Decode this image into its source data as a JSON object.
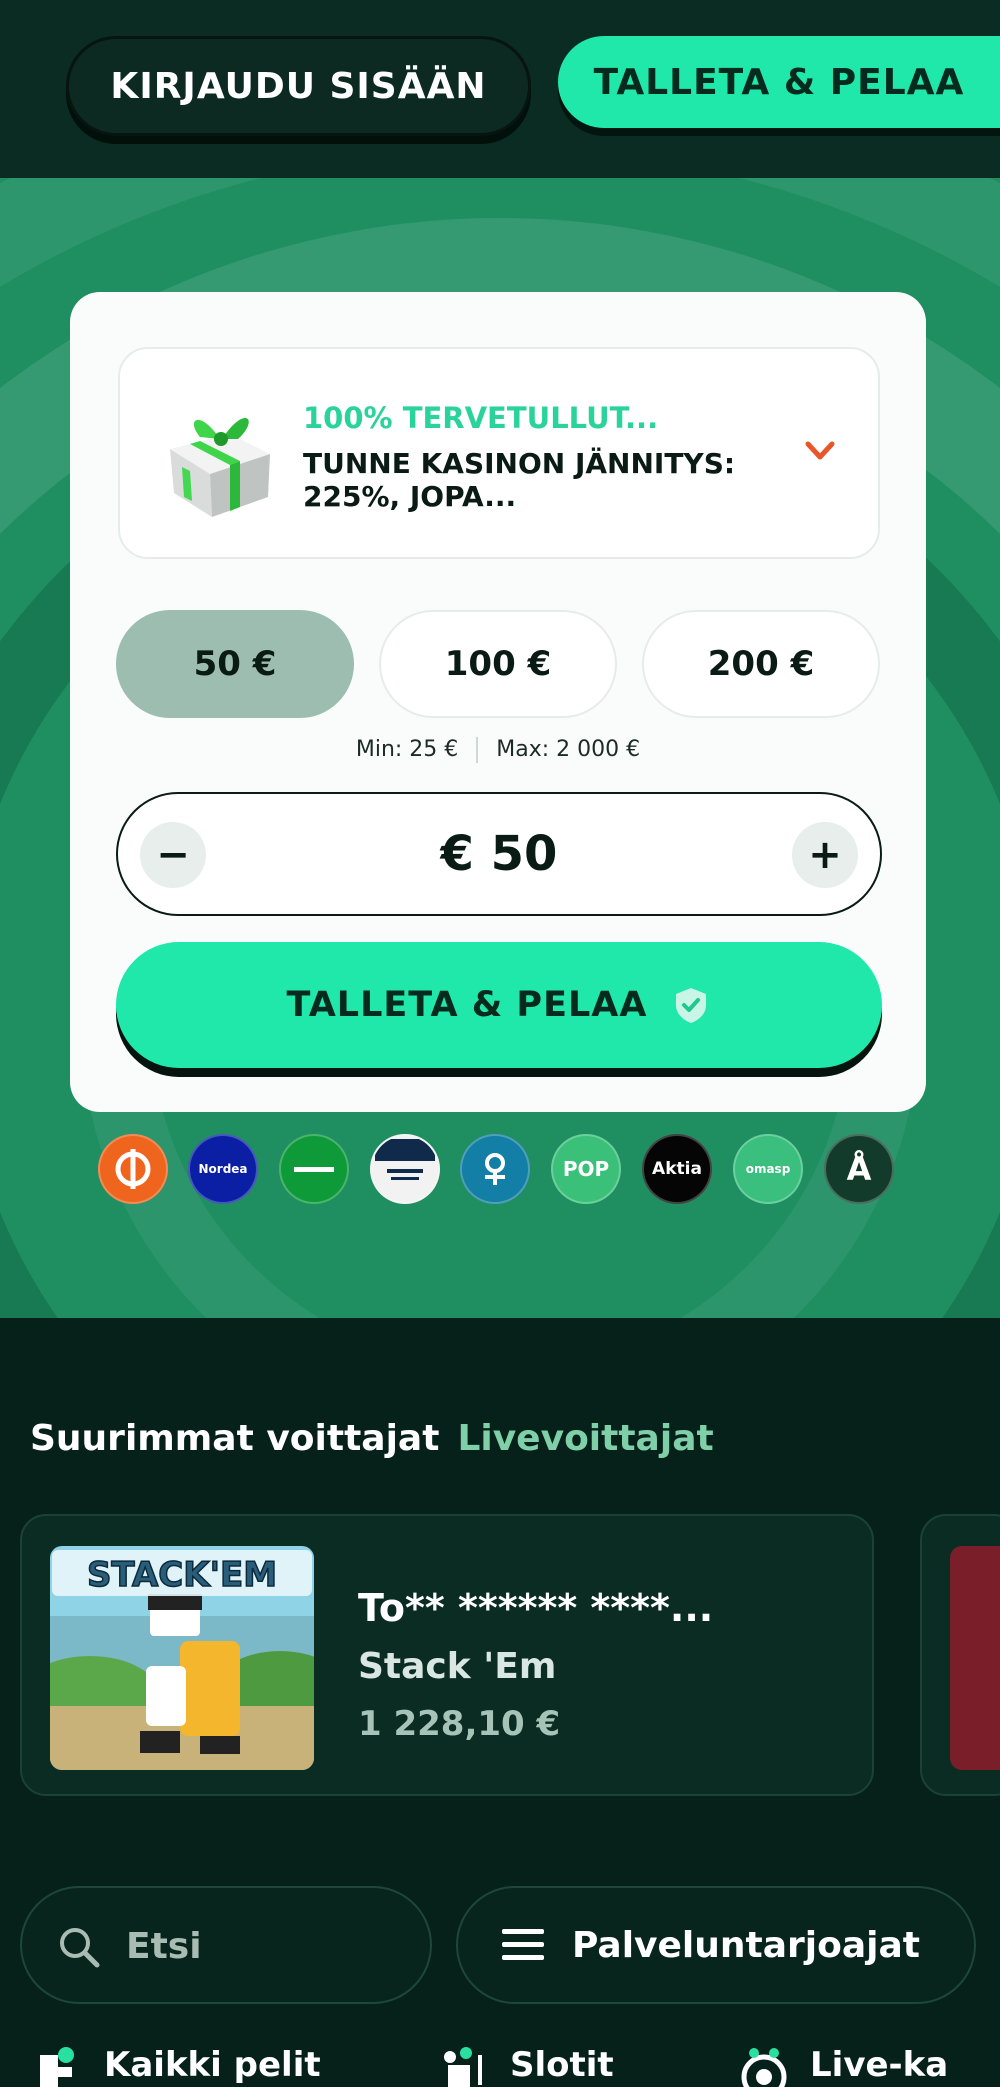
{
  "header": {
    "login_label": "KIRJAUDU SISÄÄN",
    "deposit_label": "TALLETA & PELAA"
  },
  "bonus": {
    "title": "100% TERVETULLUT...",
    "description": "TUNNE KASINON JÄNNITYS: 225%, JOPA..."
  },
  "amounts": [
    "50 €",
    "100 €",
    "200 €"
  ],
  "limits": {
    "min": "Min: 25 €",
    "max": "Max: 2 000 €"
  },
  "stepper": {
    "minus": "−",
    "value": "€ 50",
    "plus": "+"
  },
  "deposit_button": {
    "label": "TALLETA & PELAA"
  },
  "payment_methods": [
    {
      "name": "op-icon",
      "text": "",
      "color": "#f0651e"
    },
    {
      "name": "nordea-icon",
      "text": "Nordea",
      "color": "#0b1fa5"
    },
    {
      "name": "handelsbanken-icon",
      "text": "",
      "color": "#0f9a3a"
    },
    {
      "name": "danske-bank-icon",
      "text": "",
      "color": "#f2f2f2"
    },
    {
      "name": "saastopankki-icon",
      "text": "",
      "color": "#137ea6"
    },
    {
      "name": "pop-icon",
      "text": "POP",
      "color": "#3bc07a"
    },
    {
      "name": "aktia-icon",
      "text": "Aktia",
      "color": "#050505"
    },
    {
      "name": "omasp-icon",
      "text": "omasp",
      "color": "#3bbf7e"
    },
    {
      "name": "alandsbanken-icon",
      "text": "Å",
      "color": "#123b2b"
    }
  ],
  "winners": {
    "tab_active": "Suurimmat voittajat",
    "tab_inactive": "Livevoittajat",
    "items": [
      {
        "player": "To** ****** ****...",
        "game": "Stack 'Em",
        "amount": "1 228,10 €",
        "thumb_text": "STACK'EM"
      }
    ]
  },
  "search": {
    "placeholder": "Etsi"
  },
  "providers": {
    "label": "Palveluntarjoajat"
  },
  "categories": [
    {
      "label": "Kaikki pelit",
      "icon": "all-games-icon"
    },
    {
      "label": "Slotit",
      "icon": "slots-icon"
    },
    {
      "label": "Live-ka",
      "icon": "live-casino-icon"
    }
  ],
  "colors": {
    "accent": "#20e8aa",
    "background": "#05211a",
    "hero": "#1f8f62",
    "bonus_title": "#2ad39a",
    "chevron": "#e8562a"
  }
}
